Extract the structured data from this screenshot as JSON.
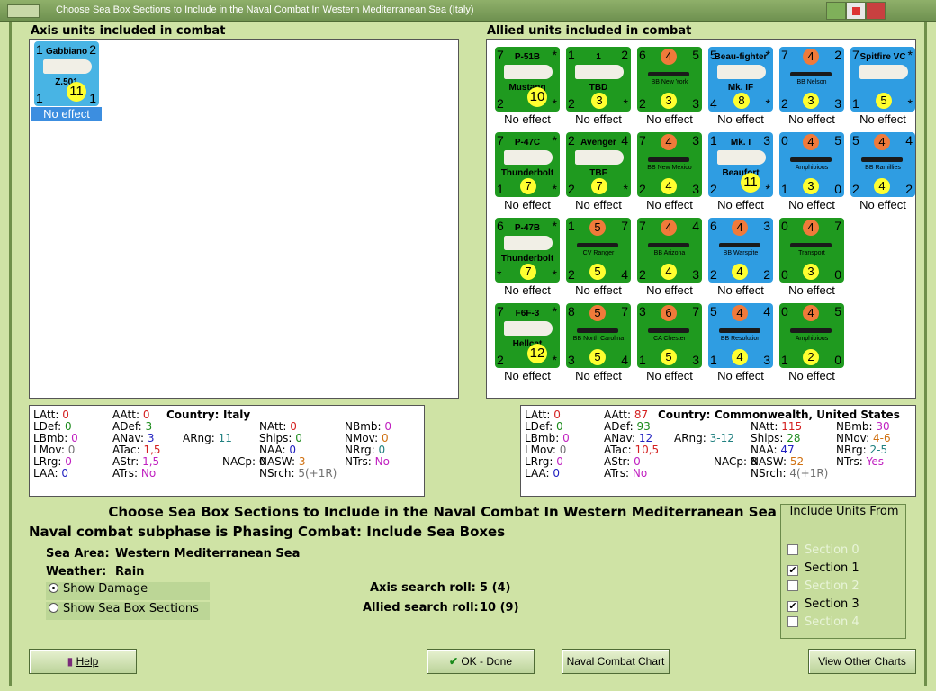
{
  "window": {
    "title": "Choose Sea Box Sections to Include in the Naval Combat In Western Mediterranean Sea (Italy)"
  },
  "axis_panel": {
    "label": "Axis units included in combat",
    "units": [
      {
        "name": "Gabbiano",
        "sub": "Z.501",
        "tl": "1",
        "tr": "2",
        "bl": "1",
        "br": "1",
        "yellow": "11",
        "result": "No effect"
      }
    ]
  },
  "allied_panel": {
    "label": "Allied units included in combat",
    "units": [
      {
        "name": "P-51B",
        "sub": "Mustang",
        "tl": "7",
        "tr": "*",
        "bl": "2",
        "br": "*",
        "yellow": "10",
        "color": "green",
        "result": "No effect"
      },
      {
        "name": "1",
        "sub": "TBD",
        "tl": "1",
        "tr": "2",
        "bl": "2",
        "br": "*",
        "yellow": "3",
        "color": "green",
        "result": "No effect"
      },
      {
        "name": "BB New York",
        "sub": "",
        "tl": "6",
        "tr": "5",
        "bl": "2",
        "br": "3",
        "orange": "4",
        "yellow": "3",
        "color": "green",
        "result": "No effect"
      },
      {
        "name": "Beau-fighter",
        "sub": "Mk. IF",
        "tl": "5",
        "tr": "*",
        "bl": "4",
        "br": "*",
        "yellow": "8",
        "color": "blue",
        "result": "No effect"
      },
      {
        "name": "BB Nelson",
        "sub": "",
        "tl": "7",
        "tr": "2",
        "bl": "2",
        "br": "3",
        "orange": "4",
        "yellow": "3",
        "color": "blue",
        "result": "No effect"
      },
      {
        "name": "Spitfire VC",
        "sub": "",
        "tl": "7",
        "tr": "*",
        "bl": "1",
        "br": "*",
        "yellow": "5",
        "color": "blue",
        "result": "No effect"
      },
      {
        "name": "P-47C",
        "sub": "Thunderbolt",
        "tl": "7",
        "tr": "*",
        "bl": "1",
        "br": "*",
        "yellow": "7",
        "color": "green",
        "result": "No effect"
      },
      {
        "name": "Avenger",
        "sub": "TBF",
        "tl": "2",
        "tr": "4",
        "bl": "2",
        "br": "*",
        "yellow": "7",
        "color": "green",
        "result": "No effect"
      },
      {
        "name": "BB New Mexico",
        "sub": "",
        "tl": "7",
        "tr": "3",
        "bl": "2",
        "br": "3",
        "orange": "4",
        "yellow": "4",
        "color": "green",
        "result": "No effect"
      },
      {
        "name": "Mk. I",
        "sub": "Beaufort",
        "tl": "1",
        "tr": "3",
        "bl": "2",
        "br": "*",
        "yellow": "11",
        "color": "blue",
        "result": "No effect"
      },
      {
        "name": "Amphibious",
        "sub": "",
        "tl": "0",
        "tr": "5",
        "bl": "1",
        "br": "0",
        "orange": "4",
        "yellow": "3",
        "color": "blue",
        "result": "No effect"
      },
      {
        "name": "BB Ramillies",
        "sub": "",
        "tl": "5",
        "tr": "4",
        "bl": "2",
        "br": "2",
        "orange": "4",
        "yellow": "4",
        "color": "blue",
        "result": "No effect"
      },
      {
        "name": "P-47B",
        "sub": "Thunderbolt",
        "tl": "6",
        "tr": "*",
        "bl": "*",
        "br": "*",
        "yellow": "7",
        "color": "green",
        "result": "No effect"
      },
      {
        "name": "CV Ranger",
        "sub": "",
        "tl": "1",
        "tr": "7",
        "bl": "2",
        "br": "4",
        "orange": "5",
        "yellow": "5",
        "color": "green",
        "result": "No effect"
      },
      {
        "name": "BB Arizona",
        "sub": "",
        "tl": "7",
        "tr": "4",
        "bl": "2",
        "br": "3",
        "orange": "4",
        "yellow": "4",
        "color": "green",
        "result": "No effect"
      },
      {
        "name": "BB Warspite",
        "sub": "",
        "tl": "6",
        "tr": "3",
        "bl": "2",
        "br": "2",
        "orange": "4",
        "yellow": "4",
        "color": "blue",
        "result": "No effect"
      },
      {
        "name": "Transport",
        "sub": "",
        "tl": "0",
        "tr": "7",
        "bl": "0",
        "br": "0",
        "orange": "4",
        "yellow": "3",
        "color": "green",
        "result": "No effect"
      },
      {
        "name": "F6F-3",
        "sub": "Hellcat",
        "tl": "7",
        "tr": "*",
        "bl": "2",
        "br": "*",
        "yellow": "12",
        "color": "green",
        "result": "No effect"
      },
      {
        "name": "BB North Carolina",
        "sub": "",
        "tl": "8",
        "tr": "7",
        "bl": "3",
        "br": "4",
        "orange": "5",
        "yellow": "5",
        "color": "green",
        "result": "No effect"
      },
      {
        "name": "CA Chester",
        "sub": "",
        "tl": "3",
        "tr": "7",
        "bl": "1",
        "br": "3",
        "orange": "6",
        "yellow": "5",
        "color": "green",
        "result": "No effect"
      },
      {
        "name": "BB Resolution",
        "sub": "",
        "tl": "5",
        "tr": "4",
        "bl": "1",
        "br": "3",
        "orange": "4",
        "yellow": "4",
        "color": "blue",
        "result": "No effect"
      },
      {
        "name": "Amphibious",
        "sub": "",
        "tl": "0",
        "tr": "5",
        "bl": "1",
        "br": "0",
        "orange": "4",
        "yellow": "2",
        "color": "green",
        "result": "No effect"
      }
    ]
  },
  "axis_stats": {
    "latt": "0",
    "ldef": "0",
    "lbmb": "0",
    "lmov": "0",
    "lrrg": "0",
    "laa": "0",
    "aatt": "0",
    "adef": "3",
    "anav": "3",
    "atac": "1,5",
    "astr": "1,5",
    "atrs": "No",
    "country_label": "Country:",
    "country": "Italy",
    "arng": "11",
    "natt": "0",
    "ships": "0",
    "naa": "0",
    "nacp": "0",
    "nasw": "3",
    "nsrch": "5(+1R)",
    "nbmb": "0",
    "nmov": "0",
    "nrrg": "0",
    "ntrs": "No"
  },
  "allied_stats": {
    "latt": "0",
    "ldef": "0",
    "lbmb": "0",
    "lmov": "0",
    "lrrg": "0",
    "laa": "0",
    "aatt": "87",
    "adef": "93",
    "anav": "12",
    "atac": "10,5",
    "astr": "0",
    "atrs": "No",
    "country_label": "Country:",
    "country": "Commonwealth, United States",
    "arng": "3-12",
    "natt": "115",
    "ships": "28",
    "naa": "47",
    "nacp": "8",
    "nasw": "52",
    "nsrch": "4(+1R)",
    "nbmb": "30",
    "nmov": "4-6",
    "nrrg": "2-5",
    "ntrs": "Yes"
  },
  "labels": {
    "latt": "LAtt:",
    "ldef": "LDef:",
    "lbmb": "LBmb:",
    "lmov": "LMov:",
    "lrrg": "LRrg:",
    "laa": "LAA:",
    "aatt": "AAtt:",
    "adef": "ADef:",
    "anav": "ANav:",
    "atac": "ATac:",
    "astr": "AStr:",
    "atrs": "ATrs:",
    "arng": "ARng:",
    "natt": "NAtt:",
    "ships": "Ships:",
    "naa": "NAA:",
    "nacp": "NACp:",
    "nasw": "NASW:",
    "nsrch": "NSrch:",
    "nbmb": "NBmb:",
    "nmov": "NMov:",
    "nrrg": "NRrg:",
    "ntrs": "NTrs:"
  },
  "main": {
    "heading": "Choose Sea Box Sections to Include in the Naval Combat In Western Mediterranean Sea (Italy)",
    "subphase": "Naval combat subphase is Phasing Combat: Include Sea Boxes",
    "sea_area_label": "Sea Area:",
    "sea_area": "Western Mediterranean Sea",
    "weather_label": "Weather:",
    "weather": "Rain",
    "axis_roll_label": "Axis search roll:",
    "axis_roll": "5 (4)",
    "allied_roll_label": "Allied search roll:",
    "allied_roll": "10 (9)",
    "show_damage": "Show Damage",
    "show_sections": "Show Sea Box Sections"
  },
  "include": {
    "title": "Include Units From",
    "sections": [
      {
        "label": "Section 0",
        "checked": false,
        "enabled": false
      },
      {
        "label": "Section 1",
        "checked": true,
        "enabled": true
      },
      {
        "label": "Section 2",
        "checked": false,
        "enabled": false
      },
      {
        "label": "Section 3",
        "checked": true,
        "enabled": true
      },
      {
        "label": "Section 4",
        "checked": false,
        "enabled": false
      }
    ]
  },
  "buttons": {
    "help": "Help",
    "ok": "OK - Done",
    "naval_chart": "Naval Combat Chart",
    "other_charts": "View Other Charts"
  },
  "colors": {
    "green": "#1f9a1f",
    "blue": "#2f9de2",
    "background": "#cfe3a5"
  }
}
